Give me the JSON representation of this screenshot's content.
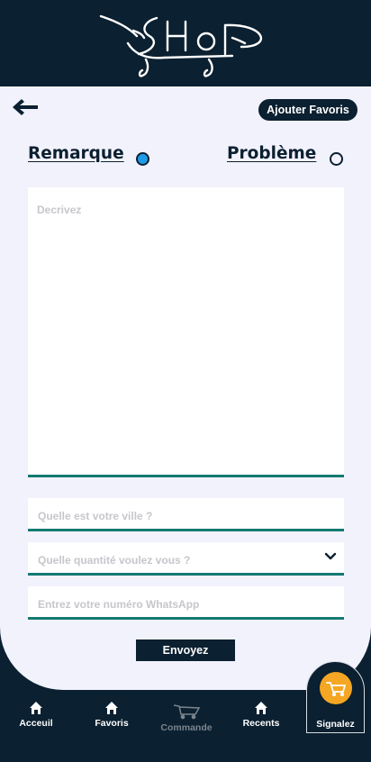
{
  "header": {
    "logo_icon": "shop-cart-logo"
  },
  "toolbar": {
    "back_icon": "arrow-left-icon",
    "add_favorite_label": "Ajouter Favoris"
  },
  "type_choice": [
    {
      "label": "Remarque",
      "selected": true
    },
    {
      "label": "Problème",
      "selected": false
    }
  ],
  "form": {
    "description_placeholder": "Decrivez",
    "city_placeholder": "Quelle est votre ville ?",
    "quantity_placeholder": "Quelle quantité voulez vous ?",
    "whatsapp_placeholder": "Entrez votre numéro WhatsApp",
    "submit_label": "Envoyez"
  },
  "colors": {
    "primary": "#0b2030",
    "accent": "#147a72",
    "radio_on": "#1d9be8",
    "signal": "#f5a623",
    "page_bg": "#f2f2fd"
  },
  "bottom_nav": {
    "items": [
      {
        "label": "Acceuil",
        "icon": "home-icon"
      },
      {
        "label": "Favoris",
        "icon": "home-icon"
      },
      {
        "label": "Commande",
        "icon": "cart-icon",
        "dimmed": true
      },
      {
        "label": "Recents",
        "icon": "home-icon"
      },
      {
        "label": "Signalez",
        "icon": "cart-icon",
        "active": true
      }
    ]
  }
}
